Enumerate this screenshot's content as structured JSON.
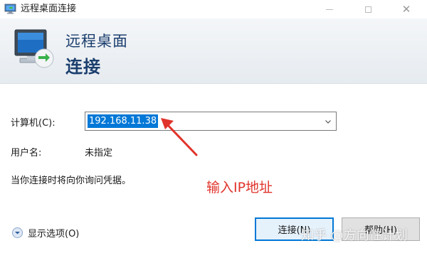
{
  "window": {
    "title": "远程桌面连接",
    "close_glyph": "✕"
  },
  "banner": {
    "line1": "远程桌面",
    "line2": "连接"
  },
  "form": {
    "computer_label": "计算机(C):",
    "computer_value": "192.168.11.38",
    "username_label": "用户名:",
    "username_value": "未指定",
    "hint": "当你连接时将向你询问凭据。"
  },
  "annotation": {
    "text": "输入IP地址",
    "color": "#e0332b"
  },
  "footer": {
    "options_label": "显示选项(O)",
    "connect_label": "连接(N)",
    "help_label": "帮助(H)"
  },
  "watermark": "知乎 @方向性计划",
  "colors": {
    "accent": "#0078d7",
    "banner_text": "#1b3f6e"
  },
  "icons": [
    "remote-desktop-icon",
    "remote-desktop-large-icon",
    "chevron-down-icon",
    "expand-options-icon",
    "red-arrow-icon"
  ]
}
